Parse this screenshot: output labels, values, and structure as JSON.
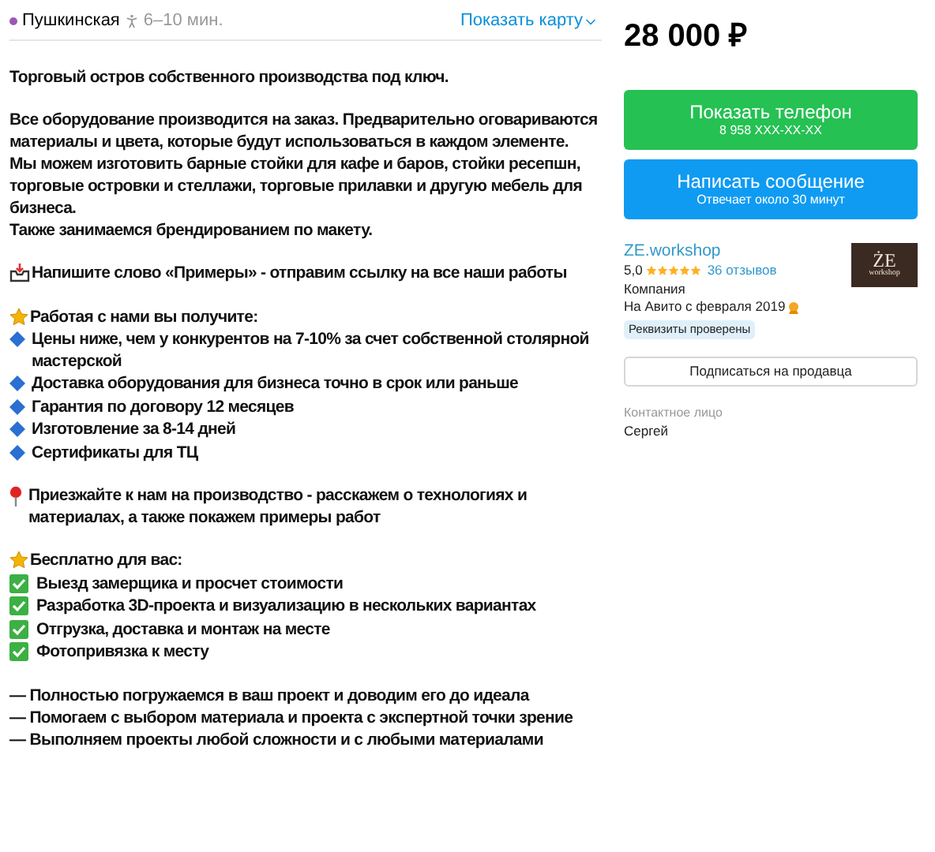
{
  "metro": {
    "station": "Пушкинская",
    "color": "#9b59b6",
    "walk_time": "6–10 мин."
  },
  "map_link": "Показать карту",
  "description": [
    {
      "lines": [
        {
          "kind": "text",
          "text": "Торговый остров собственного производства под ключ."
        }
      ]
    },
    {
      "lines": [
        {
          "kind": "text",
          "text": "Все оборудование производится на заказ. Предварительно оговариваются материалы и цвета, которые будут использоваться в каждом элементе."
        },
        {
          "kind": "text",
          "text": "Мы можем изготовить барные стойки для кафе и баров, стойки ресепшн, торговые островки и стеллажи, торговые прилавки и другую мебель для бизнеса."
        },
        {
          "kind": "text",
          "text": "Также занимаемся брендированием по макету."
        }
      ]
    },
    {
      "lines": [
        {
          "kind": "inbox",
          "text": "Напишите слово «Примеры» - отправим ссылку на все наши работы"
        }
      ]
    },
    {
      "lines": [
        {
          "kind": "star",
          "text": "Работая с нами вы получите:"
        },
        {
          "kind": "diamond",
          "text": "Цены ниже, чем у конкурентов на 7-10% за счет собственной столярной мастерской"
        },
        {
          "kind": "diamond",
          "text": "Доставка оборудования для бизнеса точно в срок или раньше"
        },
        {
          "kind": "diamond",
          "text": "Гарантия по договору 12 месяцев"
        },
        {
          "kind": "diamond",
          "text": "Изготовление за 8-14 дней"
        },
        {
          "kind": "diamond",
          "text": "Сертификаты для ТЦ"
        }
      ]
    },
    {
      "lines": [
        {
          "kind": "pin",
          "text": "Приезжайте к нам на производство - расскажем о технологиях и материалах, а также покажем примеры работ"
        }
      ]
    },
    {
      "lines": [
        {
          "kind": "star",
          "text": "Бесплатно для вас:"
        },
        {
          "kind": "check",
          "text": "Выезд замерщика и просчет стоимости"
        },
        {
          "kind": "check",
          "text": "Разработка 3D-проекта и визуализацию в нескольких вариантах"
        },
        {
          "kind": "check",
          "text": "Отгрузка, доставка и монтаж на месте"
        },
        {
          "kind": "check",
          "text": "Фотопривязка к месту"
        }
      ]
    },
    {
      "lines": [
        {
          "kind": "text",
          "text": "— Полностью погружаемся в ваш проект и доводим его до идеала"
        },
        {
          "kind": "text",
          "text": "— Помогаем с выбором материала и проекта с экспертной точки зрение"
        },
        {
          "kind": "text",
          "text": "— Выполняем проекты любой сложности и с любыми материалами"
        }
      ]
    }
  ],
  "price": "28 000 ₽",
  "phone_button": {
    "label": "Показать телефон",
    "sub": "8 958 XXX-XX-XX"
  },
  "message_button": {
    "label": "Написать сообщение",
    "sub": "Отвечает около 30 минут"
  },
  "seller": {
    "name": "ZE.workshop",
    "rating": "5,0",
    "stars": 5,
    "reviews": "36 отзывов",
    "type": "Компания",
    "since": "На Авито с февраля 2019",
    "badge": "Реквизиты проверены",
    "logo_text": "ŻE",
    "logo_sub": "workshop"
  },
  "subscribe_button": "Подписаться на продавца",
  "contact": {
    "label": "Контактное лицо",
    "name": "Сергей"
  }
}
